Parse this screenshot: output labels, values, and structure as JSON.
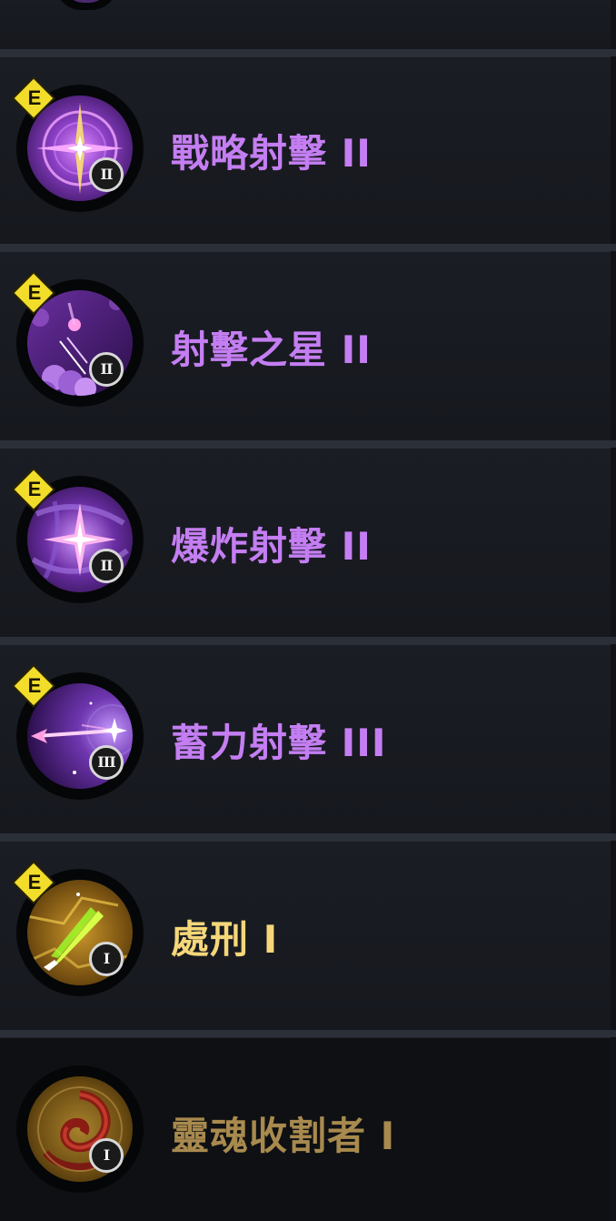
{
  "skills": [
    {
      "name": "戰略射擊 II",
      "rank": "II",
      "tag": "E",
      "icon": "compass-star-icon",
      "color": "#c47ef2"
    },
    {
      "name": "射擊之星 II",
      "rank": "II",
      "tag": "E",
      "icon": "falling-star-icon",
      "color": "#c47ef2"
    },
    {
      "name": "爆炸射擊 II",
      "rank": "II",
      "tag": "E",
      "icon": "burst-sparkle-icon",
      "color": "#c47ef2"
    },
    {
      "name": "蓄力射擊 III",
      "rank": "III",
      "tag": "E",
      "icon": "charged-arrow-icon",
      "color": "#c47ef2"
    },
    {
      "name": "處刑 I",
      "rank": "I",
      "tag": "E",
      "icon": "execution-blade-icon",
      "color": "#f5d77a"
    },
    {
      "name": "靈魂收割者 I",
      "rank": "I",
      "tag": "",
      "icon": "soul-reaper-icon",
      "color": "#a88a4e"
    }
  ]
}
